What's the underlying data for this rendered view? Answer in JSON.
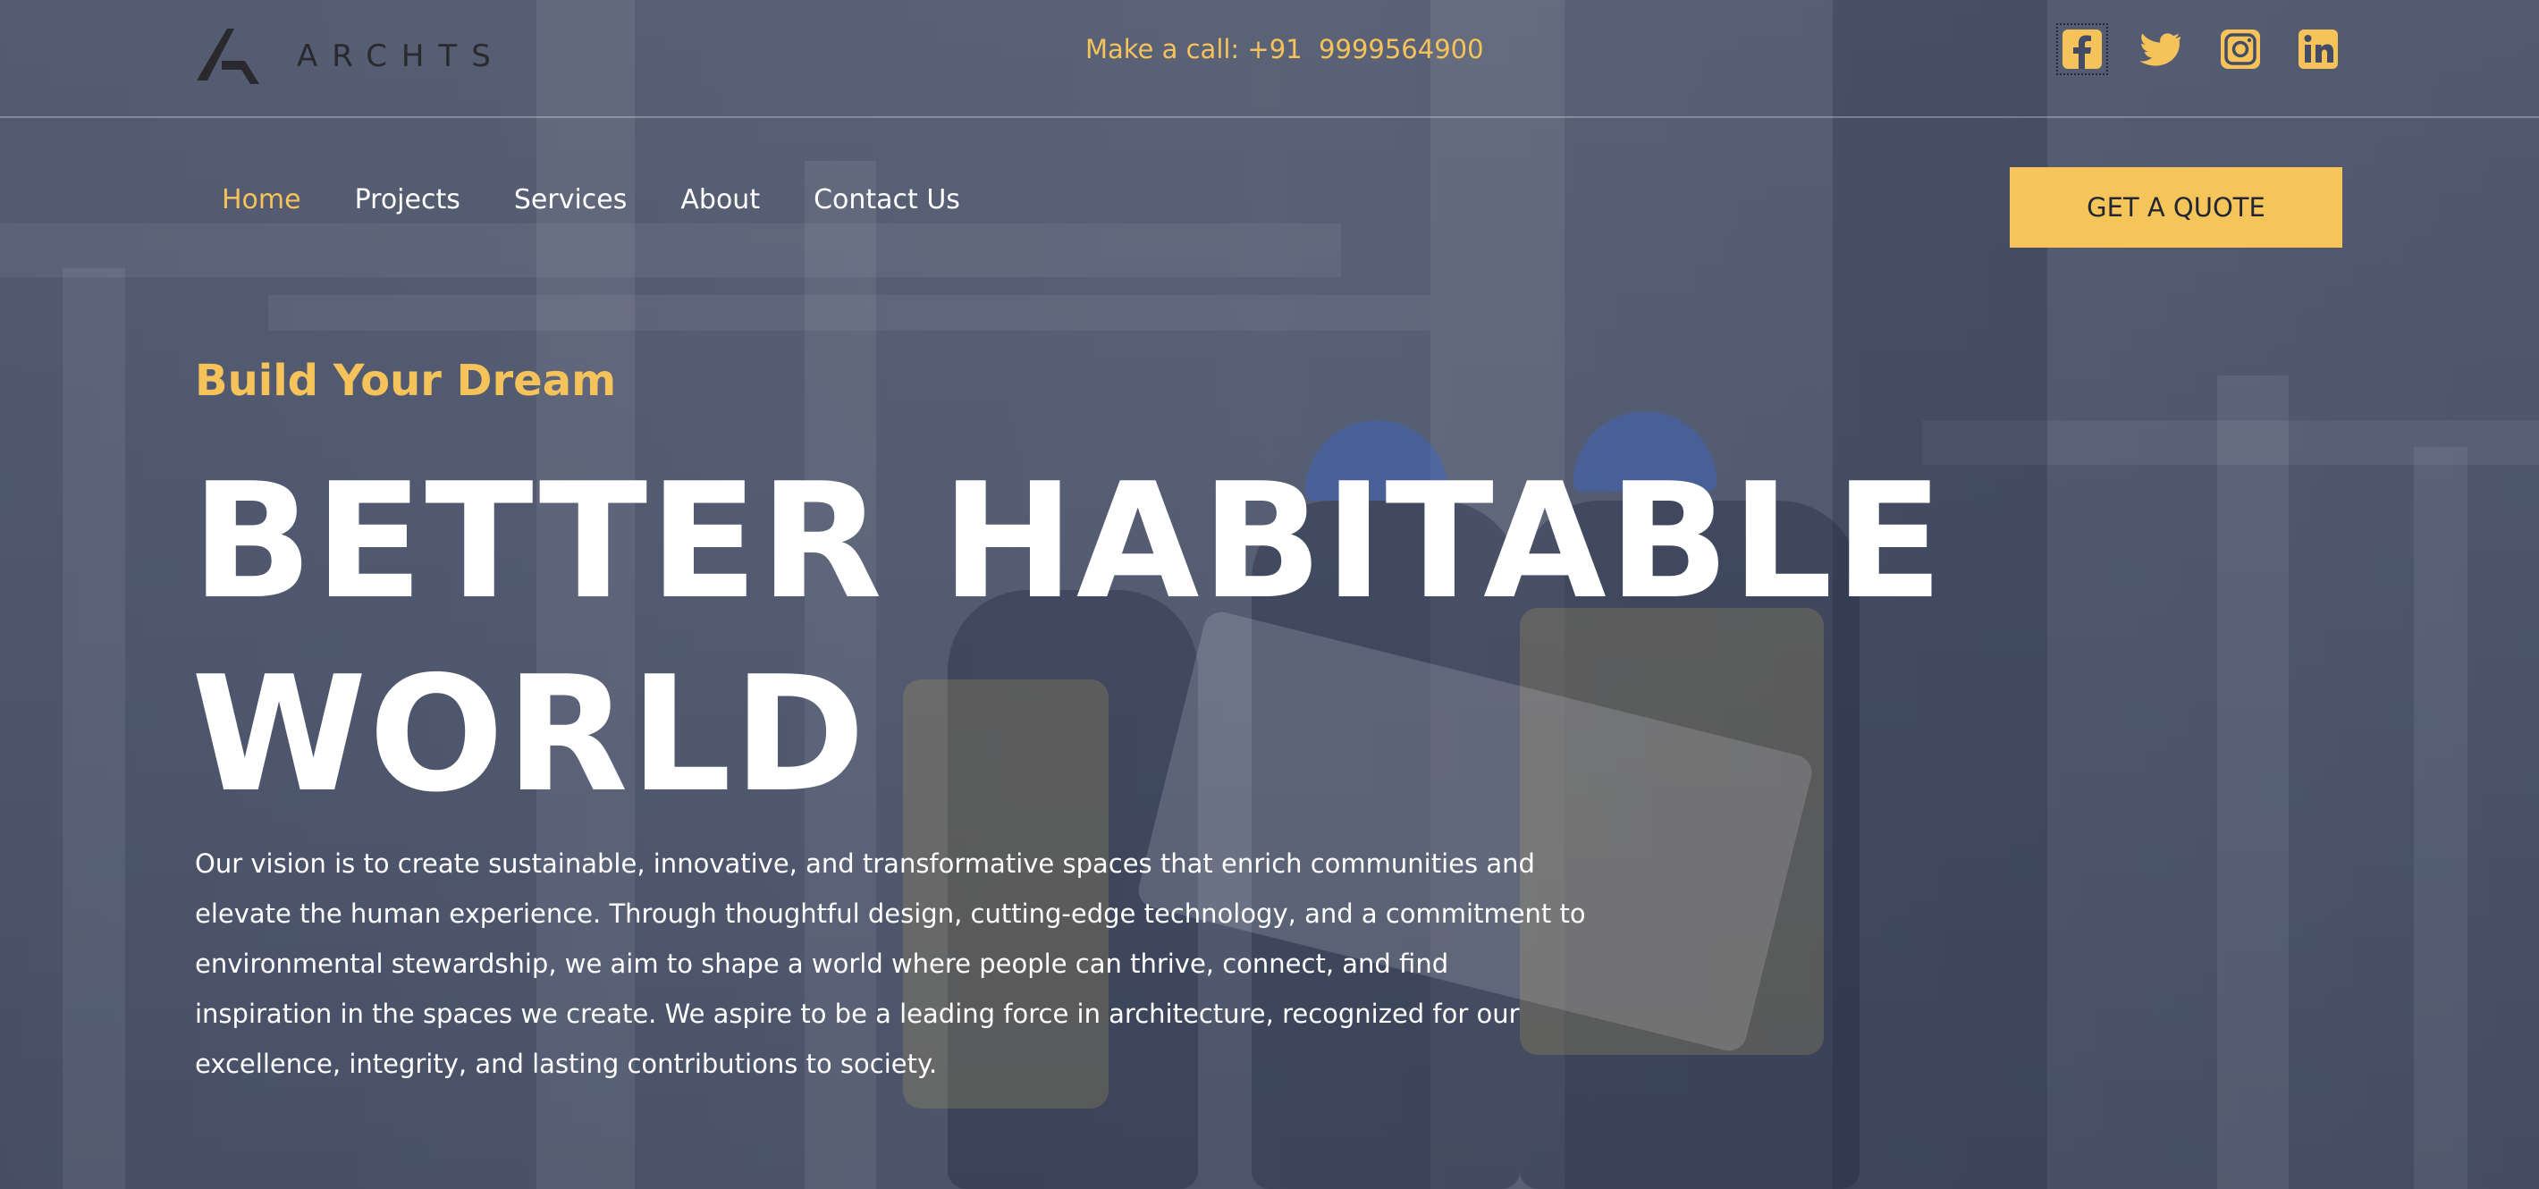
{
  "brand": {
    "name": "ARCHTS"
  },
  "contact": {
    "call_text": "Make a call: +91  9999564900"
  },
  "social": [
    {
      "icon": "facebook-icon"
    },
    {
      "icon": "twitter-icon"
    },
    {
      "icon": "instagram-icon"
    },
    {
      "icon": "linkedin-icon"
    }
  ],
  "nav": {
    "items": [
      {
        "label": "Home",
        "active": true
      },
      {
        "label": "Projects"
      },
      {
        "label": "Services"
      },
      {
        "label": "About"
      },
      {
        "label": "Contact Us"
      }
    ],
    "cta_label": "GET A QUOTE"
  },
  "hero": {
    "tagline": "Build Your Dream",
    "headline_line1": "BETTER HABITABLE",
    "headline_line2": "WORLD",
    "vision": "Our vision is to create sustainable, innovative, and transformative spaces that enrich communities and elevate the human experience. Through thoughtful design, cutting-edge technology, and a commitment to environmental stewardship, we aim to shape a world where people can thrive, connect, and find inspiration in the spaces we create. We aspire to be a leading force in architecture, recognized for our excellence, integrity, and lasting contributions to society."
  },
  "colors": {
    "accent": "#f5c35a",
    "overlay": "#434c64",
    "text": "#ffffff",
    "logo": "#2a2a2e"
  }
}
